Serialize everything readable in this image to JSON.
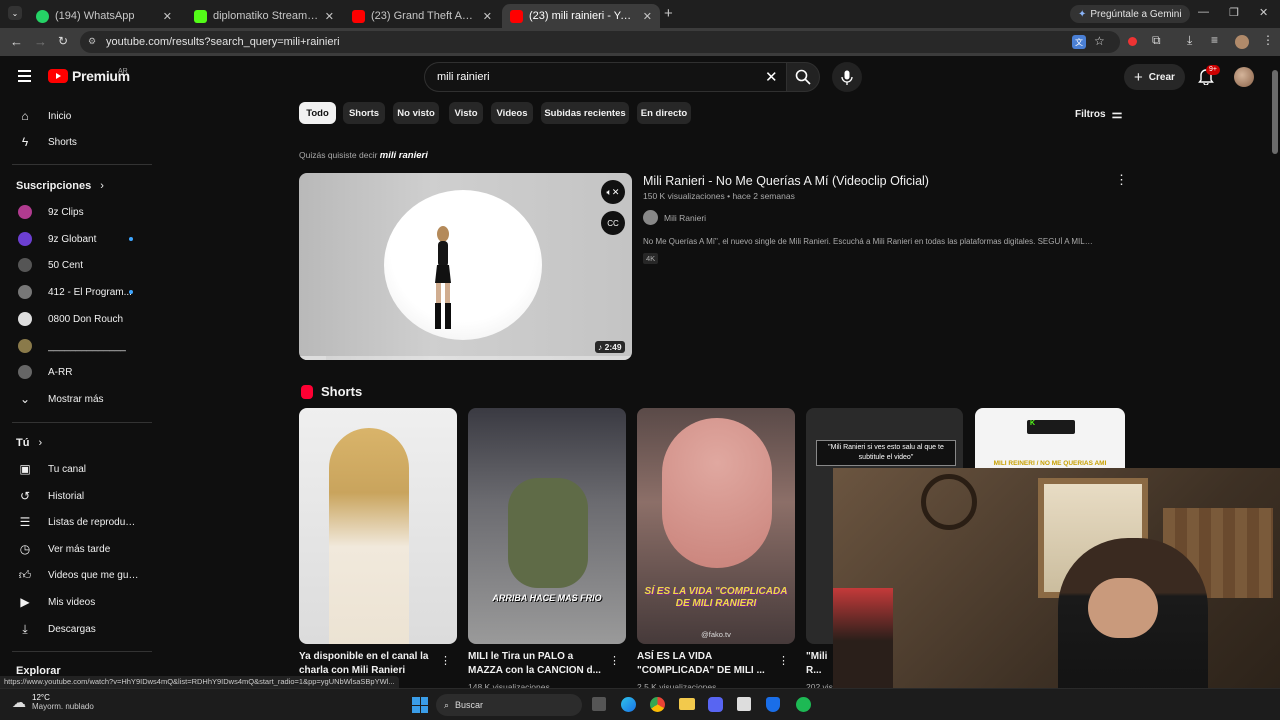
{
  "browser": {
    "tabs": [
      {
        "title": "(194) WhatsApp",
        "icon": "whatsapp-icon",
        "color": "#25d366"
      },
      {
        "title": "diplomatiko Stream - Watch Live",
        "icon": "kick-icon",
        "color": "#53fc18"
      },
      {
        "title": "(23) Grand Theft Auto VI: An En",
        "icon": "youtube-icon",
        "color": "#ff0000"
      },
      {
        "title": "(23) mili rainieri - YouTube",
        "icon": "youtube-icon",
        "color": "#ff0000"
      }
    ],
    "gemini_label": "Pregúntale a Gemini",
    "url": "youtube.com/results?search_query=mili+rainieri"
  },
  "header": {
    "logo_text": "Premium",
    "region": "AR",
    "search_value": "mili rainieri",
    "create_label": "Crear",
    "notif_badge": "9+"
  },
  "sidebar": {
    "main": [
      {
        "label": "Inicio",
        "icon": "home-icon"
      },
      {
        "label": "Shorts",
        "icon": "shorts-icon"
      }
    ],
    "subs_title": "Suscripciones",
    "subs": [
      {
        "label": "9z Clips",
        "color": "#b03b8f",
        "dot": false
      },
      {
        "label": "9z Globant",
        "color": "#6c3fd1",
        "dot": true
      },
      {
        "label": "50 Cent",
        "color": "#555555",
        "dot": false
      },
      {
        "label": "412 - El Program...",
        "color": "#777777",
        "dot": true
      },
      {
        "label": "0800 Don Rouch",
        "color": "#dddddd",
        "dot": false
      },
      {
        "label": "______________",
        "color": "#8a7a4a",
        "dot": false
      },
      {
        "label": "A-RR",
        "color": "#666666",
        "dot": false
      }
    ],
    "show_more": "Mostrar más",
    "you_title": "Tú",
    "you": [
      {
        "label": "Tu canal",
        "icon": "channel-icon"
      },
      {
        "label": "Historial",
        "icon": "history-icon"
      },
      {
        "label": "Listas de reproducc...",
        "icon": "playlists-icon"
      },
      {
        "label": "Ver más tarde",
        "icon": "clock-icon"
      },
      {
        "label": "Videos que me gus...",
        "icon": "thumbs-up-icon"
      },
      {
        "label": "Mis videos",
        "icon": "my-videos-icon"
      },
      {
        "label": "Descargas",
        "icon": "download-icon"
      }
    ],
    "explore_title": "Explorar"
  },
  "filters": {
    "chips": [
      "Todo",
      "Shorts",
      "No visto",
      "Visto",
      "Videos",
      "Subidas recientes",
      "En directo"
    ],
    "active": 0,
    "filters_label": "Filtros"
  },
  "suggestion": {
    "prefix": "Quizás quisiste decir",
    "term": "mili ranieri"
  },
  "video": {
    "title": "Mili Ranieri - No Me Querías A Mí (Videoclip Oficial)",
    "meta": "150 K visualizaciones • hace 2 semanas",
    "channel": "Mili Ranieri",
    "description": "No Me Querías A Mí\", el nuevo single de Mili Ranieri. Escuchá a Mili Ranieri en todas las plataformas digitales. SEGUÍ A MILI ...",
    "badge": "4K",
    "duration": "2:49",
    "progress": 0.08
  },
  "shorts": {
    "title": "Shorts",
    "items": [
      {
        "title": "Ya disponible en el canal la charla con Mili Ranieri",
        "views": "",
        "overlay": ""
      },
      {
        "title": "MILI le Tira un PALO a MAZZA con la CANCION d...",
        "views": "148 K visualizaciones",
        "overlay": "ARRIBA HACE MAS FRIO"
      },
      {
        "title": "ASÍ ES LA VIDA \"COMPLICADA\" DE MILI ...",
        "views": "2,5 K visualizaciones",
        "overlay": "SÍ ES LA VIDA \"COMPLICADA DE MILI RANIERI"
      },
      {
        "title": "\"Mili R... echa ...",
        "views": "202 vis",
        "overlay": "\"Mili Ranieri si ves esto salu al que te subtitule el video\""
      },
      {
        "title": "",
        "views": "",
        "overlay": "MILI REINERI / NO ME QUERIAS AMI"
      }
    ],
    "watermark": "@fako.tv"
  },
  "statusbar": {
    "url": "https://www.youtube.com/watch?v=HhY9IDws4mQ&list=RDHhY9IDws4mQ&start_radio=1&pp=ygUNbWlsaSBpYWl..."
  },
  "taskbar": {
    "temp": "12°C",
    "weather": "Mayorm. nublado",
    "search_label": "Buscar"
  }
}
